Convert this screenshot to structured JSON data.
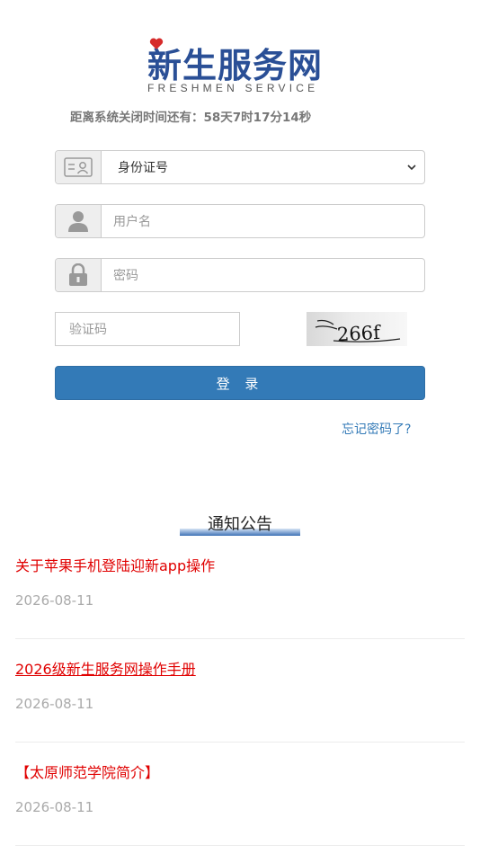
{
  "logo": {
    "title_cn": "新生服务网",
    "title_en": "FRESHMEN SERVICE"
  },
  "countdown": "距离系统关闭时间还有：58天7时17分14秒",
  "form": {
    "id_type": {
      "selected": "身份证号"
    },
    "username": {
      "placeholder": "用户名"
    },
    "password": {
      "placeholder": "密码"
    },
    "captcha": {
      "placeholder": "验证码",
      "image_text": "266f"
    },
    "login_label": "登 录",
    "forgot_label": "忘记密码了?"
  },
  "notices": {
    "heading": "通知公告",
    "items": [
      {
        "title": "关于苹果手机登陆迎新app操作",
        "date": "2026-08-11"
      },
      {
        "title": "2026级新生服务网操作手册",
        "date": "2026-08-11"
      },
      {
        "title": "【太原师范学院简介】",
        "date": "2026-08-11"
      }
    ]
  },
  "colors": {
    "brand": "#2a4f96",
    "primary": "#337ab7",
    "notice_title": "#e00000",
    "date": "#aaaaaa"
  }
}
